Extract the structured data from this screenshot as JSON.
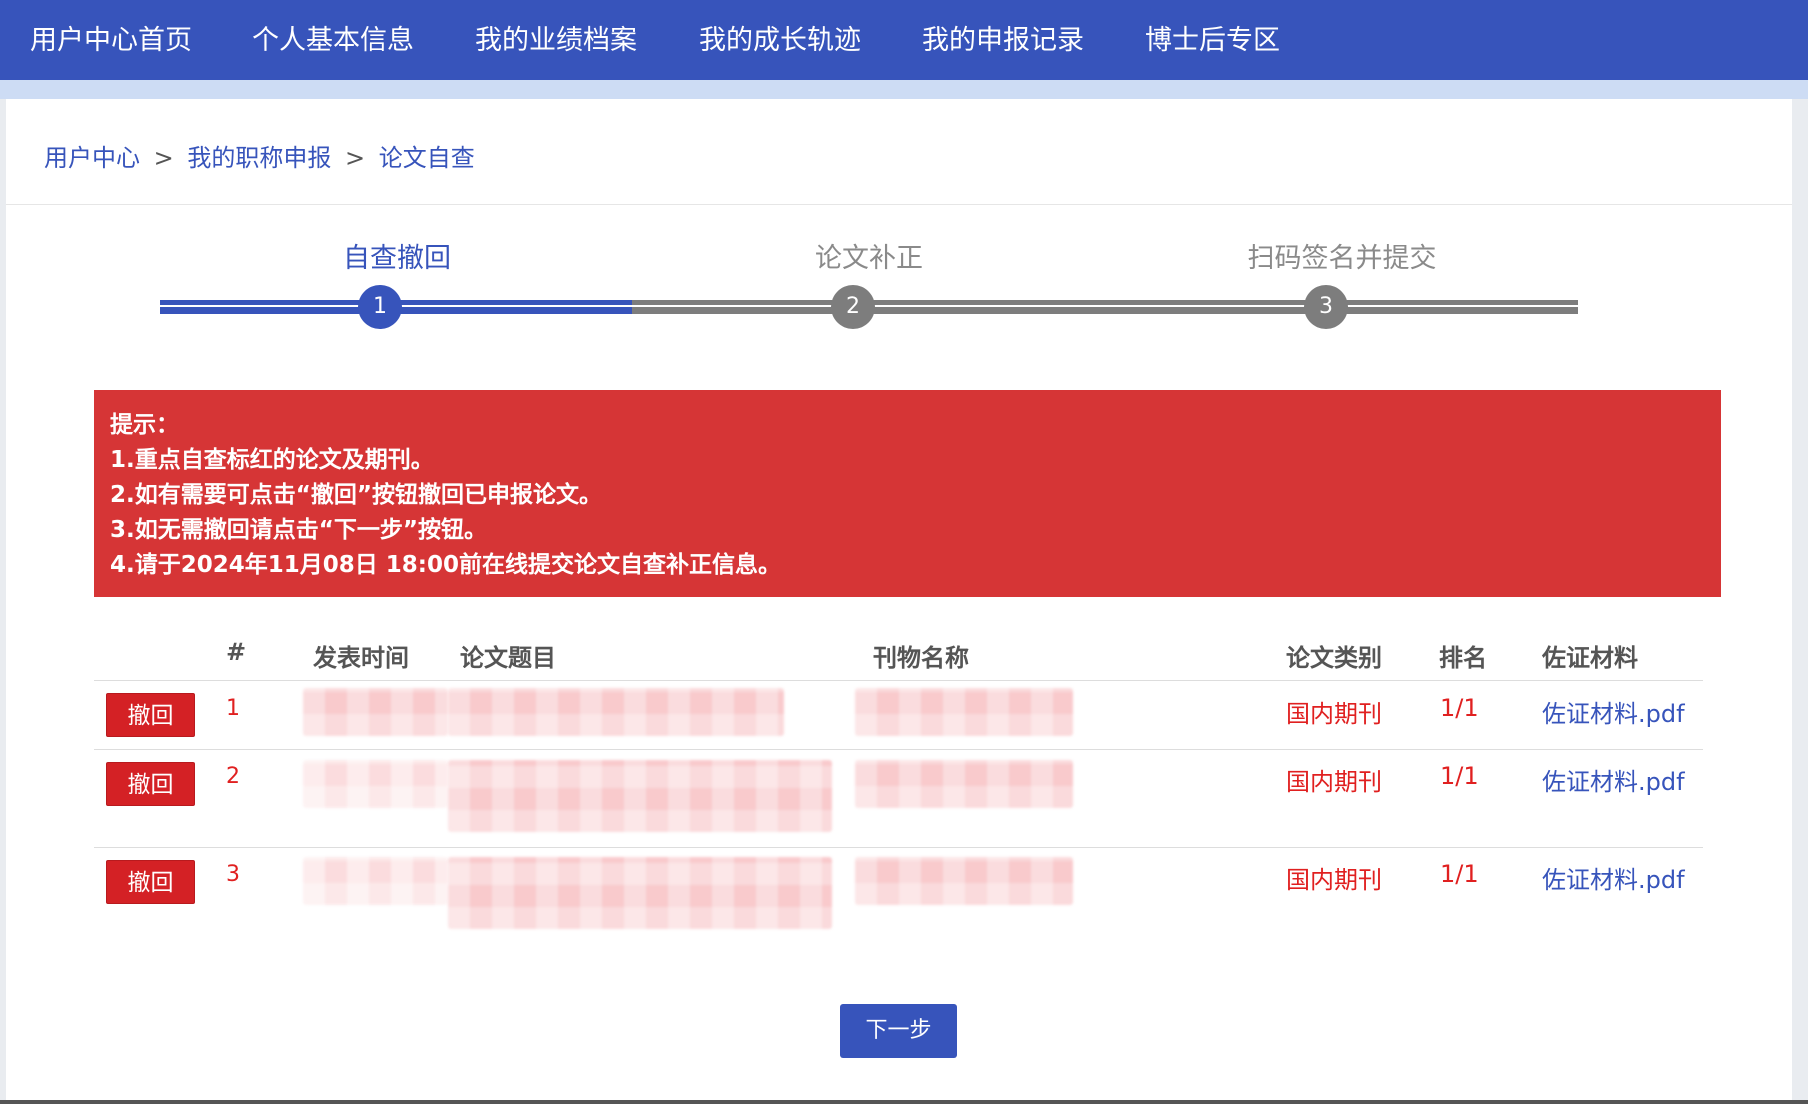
{
  "nav": {
    "items": [
      {
        "label": "用户中心首页"
      },
      {
        "label": "个人基本信息"
      },
      {
        "label": "我的业绩档案"
      },
      {
        "label": "我的成长轨迹"
      },
      {
        "label": "我的申报记录"
      },
      {
        "label": "博士后专区"
      }
    ]
  },
  "breadcrumb": {
    "items": [
      "用户中心",
      "我的职称申报",
      "论文自查"
    ],
    "separator": ">"
  },
  "steps": [
    {
      "label": "自查撤回",
      "number": "1",
      "state": "active"
    },
    {
      "label": "论文补正",
      "number": "2",
      "state": "inactive"
    },
    {
      "label": "扫码签名并提交",
      "number": "3",
      "state": "inactive"
    }
  ],
  "alert": {
    "title": "提示：",
    "lines": [
      "1.重点自查标红的论文及期刊。",
      "2.如有需要可点击“撤回”按钮撤回已申报论文。",
      "3.如无需撤回请点击“下一步”按钮。",
      "4.请于2024年11月08日 18:00前在线提交论文自查补正信息。"
    ]
  },
  "table": {
    "headers": {
      "index": "#",
      "time": "发表时间",
      "title": "论文题目",
      "journal": "刊物名称",
      "category": "论文类别",
      "rank": "排名",
      "evidence": "佐证材料"
    },
    "rows": [
      {
        "action": "撤回",
        "index": "1",
        "category": "国内期刊",
        "rank": "1/1",
        "evidence": "佐证材料.pdf"
      },
      {
        "action": "撤回",
        "index": "2",
        "category": "国内期刊",
        "rank": "1/1",
        "evidence": "佐证材料.pdf"
      },
      {
        "action": "撤回",
        "index": "3",
        "category": "国内期刊",
        "rank": "1/1",
        "evidence": "佐证材料.pdf"
      }
    ]
  },
  "next_button": {
    "label": "下一步"
  },
  "colors": {
    "primary": "#3754bb",
    "danger": "#d63536",
    "inactive_step": "#7d7d7d",
    "highlight_text": "#e02020"
  }
}
